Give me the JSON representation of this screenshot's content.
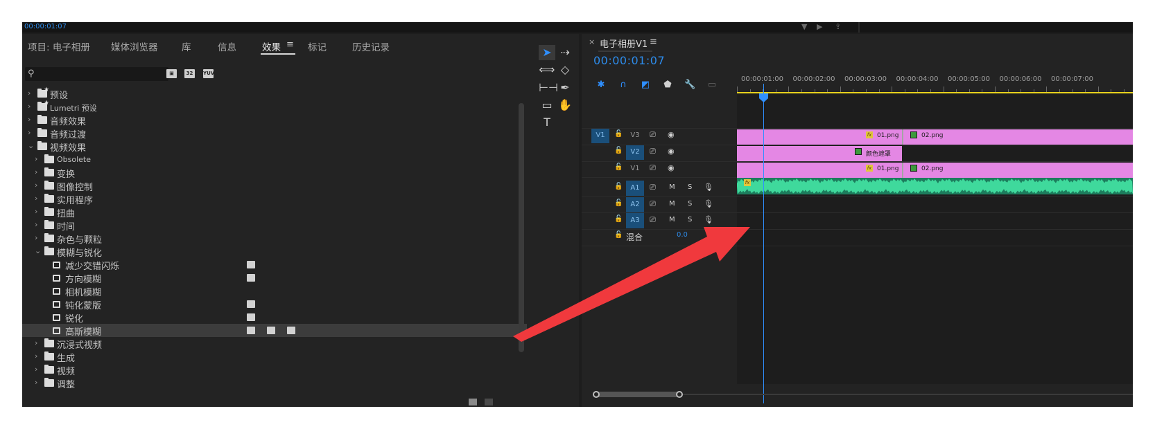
{
  "topbar": {
    "timecode": "00:00:01:07"
  },
  "effects_panel": {
    "tabs": [
      {
        "label": "项目: 电子相册"
      },
      {
        "label": "媒体浏览器"
      },
      {
        "label": "库"
      },
      {
        "label": "信息"
      },
      {
        "label": "效果",
        "active": true
      },
      {
        "label": "标记"
      },
      {
        "label": "历史记录"
      }
    ],
    "tab_menu_glyph": "≡",
    "search": {
      "placeholder": "",
      "value": ""
    },
    "filter_buttons": [
      "accelerated",
      "32",
      "YUV"
    ],
    "tree": [
      {
        "label": "预设",
        "level": 0,
        "kind": "preset-folder",
        "state": "collapsed"
      },
      {
        "label": "Lumetri 预设",
        "level": 0,
        "kind": "preset-folder",
        "state": "collapsed"
      },
      {
        "label": "音频效果",
        "level": 0,
        "kind": "folder",
        "state": "collapsed"
      },
      {
        "label": "音频过渡",
        "level": 0,
        "kind": "folder",
        "state": "collapsed"
      },
      {
        "label": "视频效果",
        "level": 0,
        "kind": "folder",
        "state": "expanded"
      },
      {
        "label": "Obsolete",
        "level": 1,
        "kind": "folder",
        "state": "collapsed"
      },
      {
        "label": "变换",
        "level": 1,
        "kind": "folder",
        "state": "collapsed"
      },
      {
        "label": "图像控制",
        "level": 1,
        "kind": "folder",
        "state": "collapsed"
      },
      {
        "label": "实用程序",
        "level": 1,
        "kind": "folder",
        "state": "collapsed"
      },
      {
        "label": "扭曲",
        "level": 1,
        "kind": "folder",
        "state": "collapsed"
      },
      {
        "label": "时间",
        "level": 1,
        "kind": "folder",
        "state": "collapsed"
      },
      {
        "label": "杂色与颗粒",
        "level": 1,
        "kind": "folder",
        "state": "collapsed"
      },
      {
        "label": "模糊与锐化",
        "level": 1,
        "kind": "folder",
        "state": "expanded"
      },
      {
        "label": "减少交错闪烁",
        "level": 2,
        "kind": "effect",
        "badges": 1
      },
      {
        "label": "方向模糊",
        "level": 2,
        "kind": "effect",
        "badges": 1
      },
      {
        "label": "相机模糊",
        "level": 2,
        "kind": "effect",
        "badges": 0
      },
      {
        "label": "钝化蒙版",
        "level": 2,
        "kind": "effect",
        "badges": 1
      },
      {
        "label": "锐化",
        "level": 2,
        "kind": "effect",
        "badges": 1
      },
      {
        "label": "高斯模糊",
        "level": 2,
        "kind": "effect",
        "badges": 3,
        "selected": true
      },
      {
        "label": "沉浸式视频",
        "level": 1,
        "kind": "folder",
        "state": "collapsed"
      },
      {
        "label": "生成",
        "level": 1,
        "kind": "folder",
        "state": "collapsed"
      },
      {
        "label": "视频",
        "level": 1,
        "kind": "folder",
        "state": "collapsed"
      },
      {
        "label": "调整",
        "level": 1,
        "kind": "folder",
        "state": "collapsed"
      }
    ]
  },
  "tools": [
    "selection-tool",
    "track-select-tool",
    "ripple-edit-tool",
    "razor-tool",
    "slip-tool",
    "pen-tool",
    "rectangle-tool",
    "hand-tool",
    "type-tool"
  ],
  "timeline": {
    "close_glyph": "×",
    "sequence_name": "电子相册V1",
    "menu_glyph": "≡",
    "timecode": "00:00:01:07",
    "ruler_labels": [
      "00:00:01:00",
      "00:00:02:00",
      "00:00:03:00",
      "00:00:04:00",
      "00:00:05:00",
      "00:00:06:00",
      "00:00:07:00"
    ],
    "video_tracks": [
      {
        "name": "V3",
        "target": "V1",
        "selected": false
      },
      {
        "name": "V2",
        "target": "",
        "selected": true
      },
      {
        "name": "V1",
        "target": "",
        "selected": false
      }
    ],
    "audio_tracks": [
      {
        "name": "A1",
        "target": "",
        "selected": true,
        "m": "M",
        "s": "S"
      },
      {
        "name": "A2",
        "target": "",
        "selected": true,
        "m": "M",
        "s": "S"
      },
      {
        "name": "A3",
        "target": "",
        "selected": true,
        "m": "M",
        "s": "S"
      }
    ],
    "mix": {
      "label": "混合",
      "value": "0.0"
    },
    "clips": {
      "v3": [
        {
          "label": "01.png",
          "fx": "fx"
        },
        {
          "label": "02.png"
        }
      ],
      "v2": [
        {
          "label": "颜色遮罩"
        }
      ],
      "v1": [
        {
          "label": "01.png",
          "fx": "fx"
        },
        {
          "label": "02.png"
        }
      ],
      "a1_fx": "fx"
    }
  },
  "colors": {
    "accent_blue": "#2d8ceb",
    "clip_pink": "#e487e4",
    "audio_green": "#1d7d5d",
    "work_area_yellow": "#e8d21c",
    "annotation_red": "#f0393d"
  }
}
